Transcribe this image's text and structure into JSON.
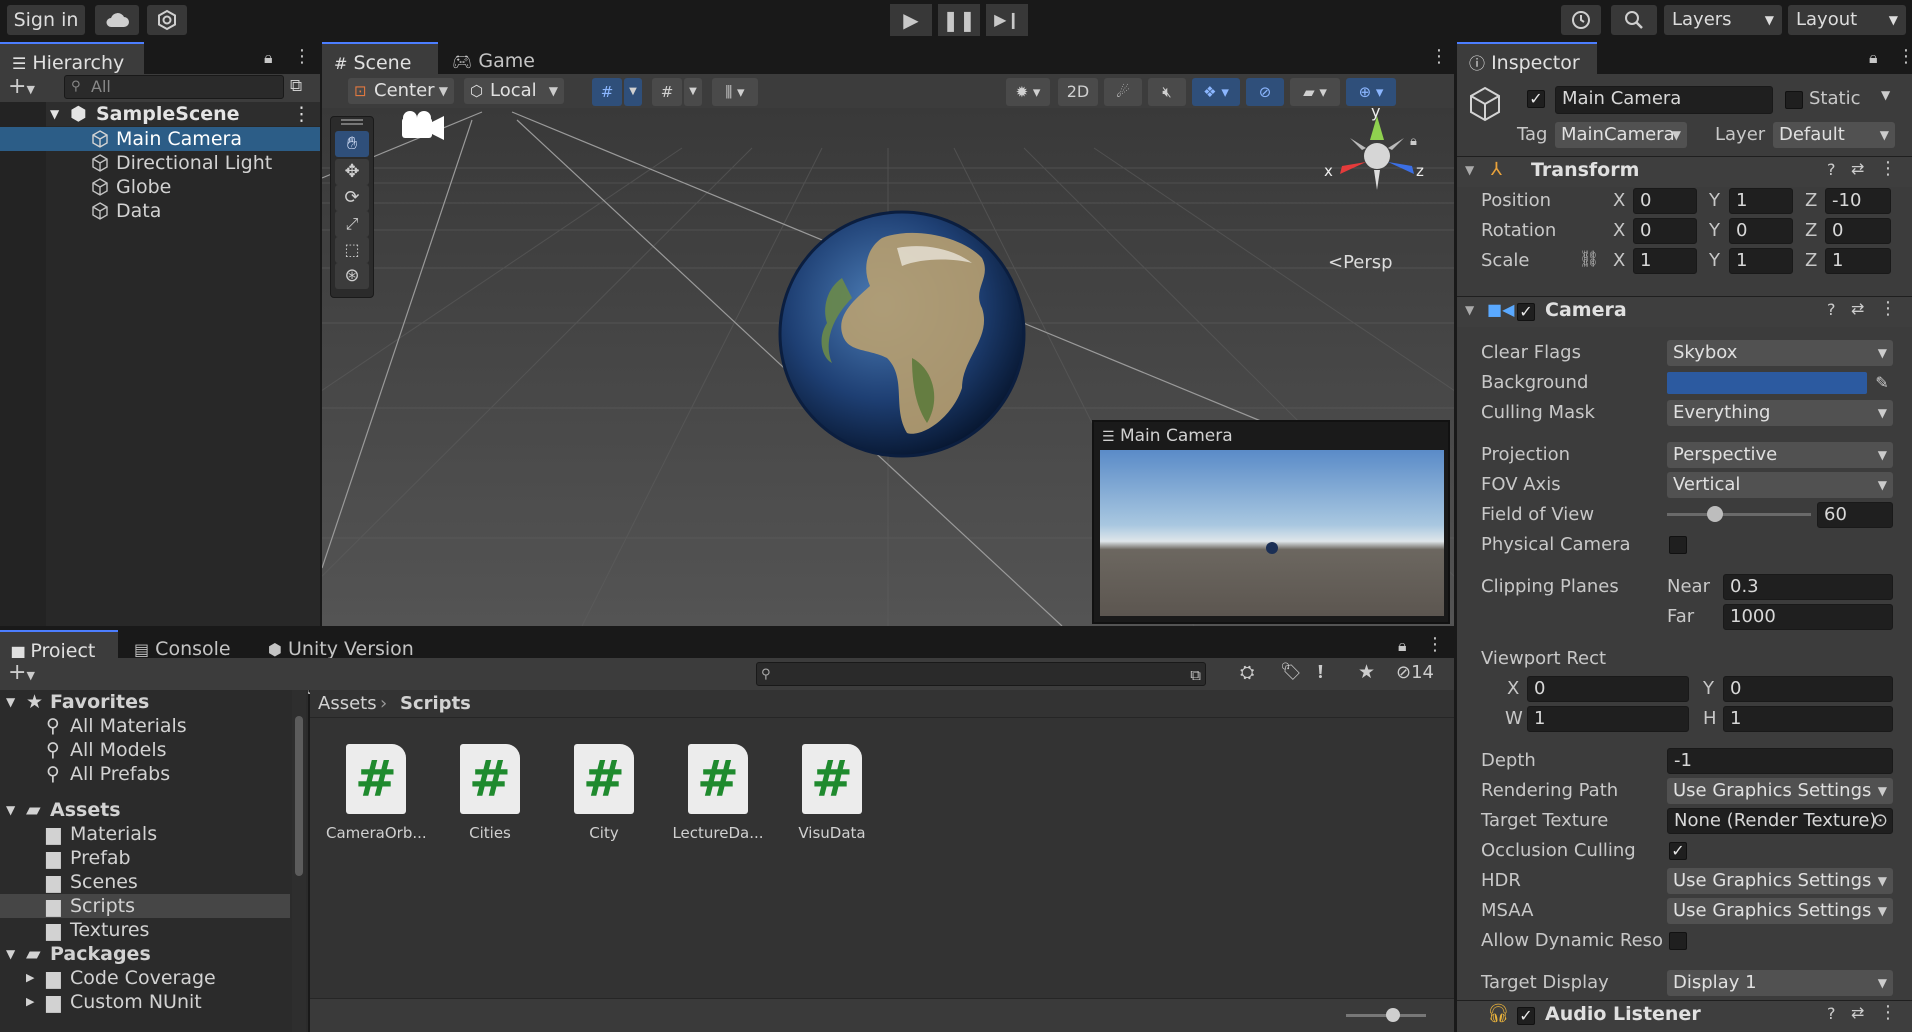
{
  "topbar": {
    "signin": "Sign in",
    "layers": "Layers",
    "layout": "Layout"
  },
  "hierarchy": {
    "tab": "Hierarchy",
    "search_placeholder": "All",
    "scene": "SampleScene",
    "items": [
      "Main Camera",
      "Directional Light",
      "Globe",
      "Data"
    ]
  },
  "scene_view": {
    "tabs": [
      "Scene",
      "Game"
    ],
    "pivot": "Center",
    "space": "Local",
    "mode2d": "2D",
    "persp": "Persp",
    "axis_y": "y",
    "axis_x": "x",
    "axis_z": "z",
    "preview_title": "Main Camera"
  },
  "project": {
    "tabs": [
      "Project",
      "Console",
      "Unity Version Control"
    ],
    "hidden_count": "14",
    "favorites": {
      "label": "Favorites",
      "items": [
        "All Materials",
        "All Models",
        "All Prefabs"
      ]
    },
    "assets": {
      "label": "Assets",
      "items": [
        "Materials",
        "Prefab",
        "Scenes",
        "Scripts",
        "Textures"
      ]
    },
    "packages": {
      "label": "Packages",
      "items": [
        "Code Coverage",
        "Custom NUnit"
      ]
    },
    "breadcrumb": [
      "Assets",
      "Scripts"
    ],
    "files": [
      "CameraOrb...",
      "Cities",
      "City",
      "LectureDa...",
      "VisuData"
    ]
  },
  "inspector": {
    "tab": "Inspector",
    "object_name": "Main Camera",
    "static_label": "Static",
    "tag_label": "Tag",
    "tag_value": "MainCamera",
    "layer_label": "Layer",
    "layer_value": "Default",
    "transform": {
      "title": "Transform",
      "position": {
        "label": "Position",
        "x": "0",
        "y": "1",
        "z": "-10"
      },
      "rotation": {
        "label": "Rotation",
        "x": "0",
        "y": "0",
        "z": "0"
      },
      "scale": {
        "label": "Scale",
        "x": "1",
        "y": "1",
        "z": "1"
      }
    },
    "camera": {
      "title": "Camera",
      "clear_flags": {
        "label": "Clear Flags",
        "value": "Skybox"
      },
      "background": {
        "label": "Background",
        "color": "#2c5aa0"
      },
      "culling_mask": {
        "label": "Culling Mask",
        "value": "Everything"
      },
      "projection": {
        "label": "Projection",
        "value": "Perspective"
      },
      "fov_axis": {
        "label": "FOV Axis",
        "value": "Vertical"
      },
      "fov": {
        "label": "Field of View",
        "value": "60",
        "slider_fraction": 0.33
      },
      "physical_camera": {
        "label": "Physical Camera"
      },
      "clipping": {
        "label": "Clipping Planes",
        "near_label": "Near",
        "near": "0.3",
        "far_label": "Far",
        "far": "1000"
      },
      "viewport": {
        "label": "Viewport Rect",
        "x": "0",
        "y": "0",
        "w": "1",
        "h": "1"
      },
      "depth": {
        "label": "Depth",
        "value": "-1"
      },
      "rendering_path": {
        "label": "Rendering Path",
        "value": "Use Graphics Settings"
      },
      "target_texture": {
        "label": "Target Texture",
        "value": "None (Render Texture)"
      },
      "occlusion": {
        "label": "Occlusion Culling"
      },
      "hdr": {
        "label": "HDR",
        "value": "Use Graphics Settings"
      },
      "msaa": {
        "label": "MSAA",
        "value": "Use Graphics Settings"
      },
      "dynamic_res": {
        "label": "Allow Dynamic Reso"
      },
      "target_display": {
        "label": "Target Display",
        "value": "Display 1"
      }
    },
    "audio_listener": {
      "title": "Audio Listener"
    }
  }
}
